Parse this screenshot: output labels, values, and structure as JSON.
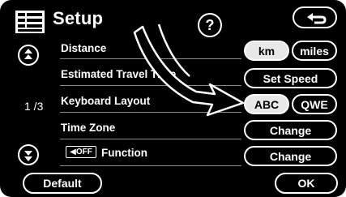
{
  "header": {
    "title": "Setup",
    "help_label": "?",
    "menu_icon": "menu-list-icon",
    "back_icon": "return-arrow-icon"
  },
  "pagination": {
    "indicator": "1 /3",
    "up_icon": "scroll-up-icon",
    "down_icon": "scroll-down-icon"
  },
  "rows": {
    "distance": {
      "label": "Distance",
      "option_a": "km",
      "option_b": "miles",
      "selected": "km"
    },
    "travel_time": {
      "label": "Estimated Travel Time",
      "button": "Set Speed"
    },
    "keyboard": {
      "label": "Keyboard Layout",
      "option_a": "ABC",
      "option_b": "QWE",
      "selected": "ABC"
    },
    "time_zone": {
      "label": "Time Zone",
      "button": "Change"
    },
    "function": {
      "badge": "◀OFF",
      "label": "Function",
      "button": "Change"
    }
  },
  "footer": {
    "default_label": "Default",
    "ok_label": "OK"
  },
  "colors": {
    "background": "#000000",
    "foreground": "#ffffff",
    "selected_fill": "#e8e8e8"
  }
}
